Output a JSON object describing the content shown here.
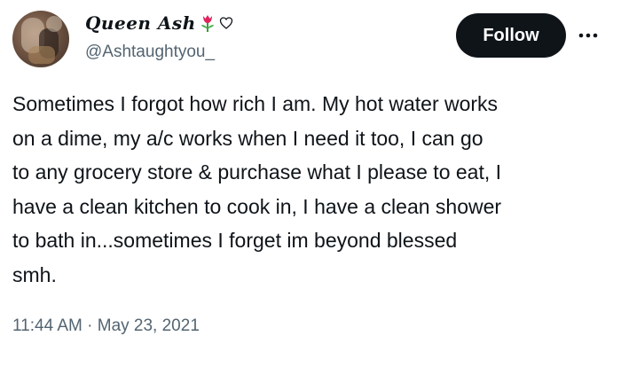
{
  "tweet": {
    "author": {
      "display_name": "Queen Ash",
      "emojis": [
        "tulip-emoji",
        "heart-outline-emoji"
      ],
      "handle": "@Ashtaughtyou_",
      "avatar": "profile-photo"
    },
    "actions": {
      "follow_label": "Follow",
      "more_icon": "more-dots-icon"
    },
    "text_lines": [
      "Sometimes I forgot how rich I am. My hot water works",
      "on a dime, my a/c works when I need it too, I can go",
      "to any grocery store & purchase what I please to eat, I",
      "have a clean kitchen to cook in, I have a clean shower",
      "to bath in...sometimes I forget im beyond blessed",
      "smh."
    ],
    "timestamp": "11:44 AM · May 23, 2021"
  },
  "colors": {
    "text_primary": "#0f1419",
    "text_secondary": "#536471",
    "button_bg": "#0f1419",
    "button_text": "#ffffff"
  }
}
